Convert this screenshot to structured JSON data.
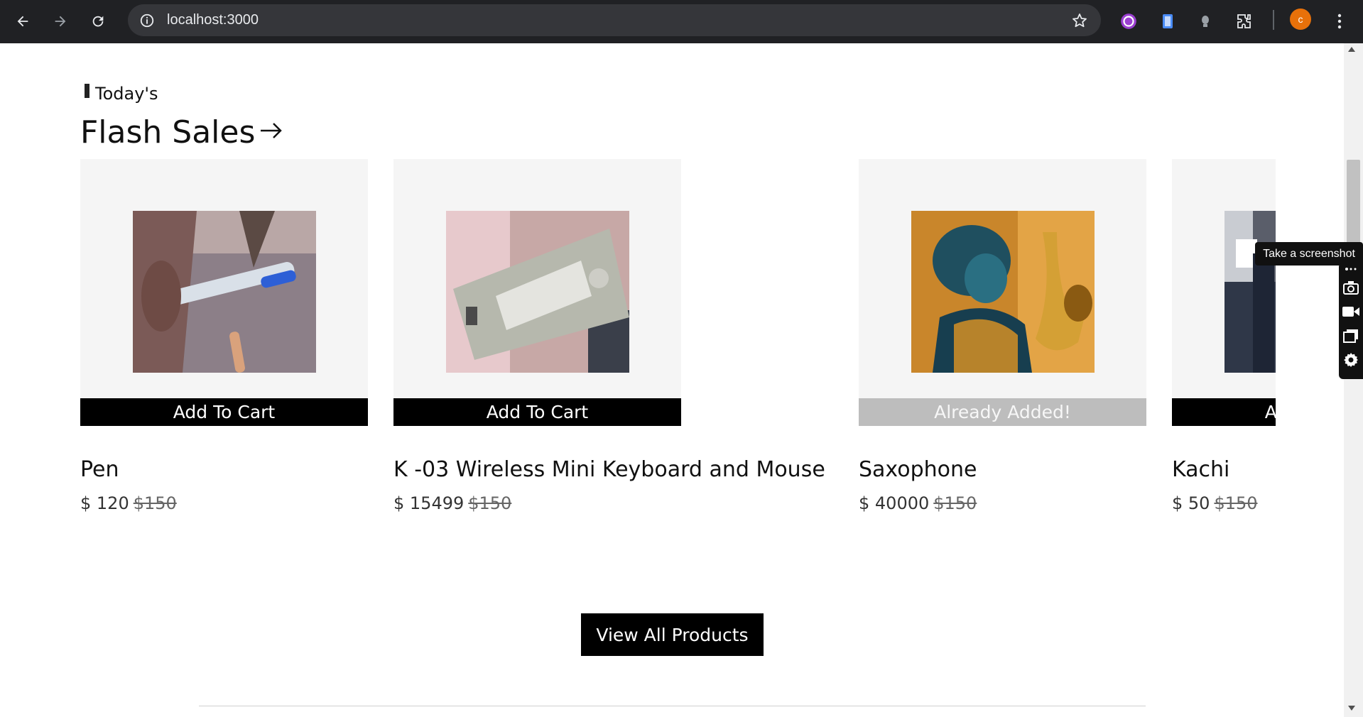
{
  "browser": {
    "url": "localhost:3000",
    "profile_initial": "c",
    "icons": [
      "back-icon",
      "forward-icon",
      "reload-icon",
      "site-info-icon",
      "star-icon",
      "extension-icon",
      "document-icon",
      "lightbulb-icon",
      "puzzle-icon",
      "menu-icon"
    ]
  },
  "section": {
    "eyebrow": "Today's",
    "title": "Flash Sales"
  },
  "products": [
    {
      "name": "Pen",
      "price": "$ 120",
      "old_price": "$150",
      "button": "Add To Cart",
      "added": false
    },
    {
      "name": "K -03 Wireless Mini Keyboard and Mouse",
      "price": "$ 15499",
      "old_price": "$150",
      "button": "Add To Cart",
      "added": false
    },
    {
      "name": "Saxophone",
      "price": "$ 40000",
      "old_price": "$150",
      "button": "Already Added!",
      "added": true
    },
    {
      "name": "Kachi",
      "price": "$ 50",
      "old_price": "$150",
      "button": "Add To Cart",
      "added": false
    }
  ],
  "view_all_label": "View All Products",
  "screenshot_tool": {
    "tooltip": "Take a screenshot",
    "tools": [
      "camera-icon",
      "video-icon",
      "window-icon",
      "settings-icon"
    ]
  },
  "colors": {
    "accent": "#000000",
    "added_button": "#bdbdbd",
    "card_bg": "#f5f5f5",
    "avatar": "#e8710a"
  }
}
